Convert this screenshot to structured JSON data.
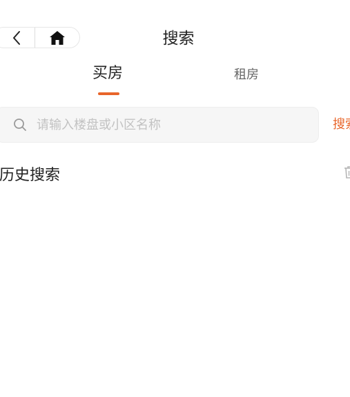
{
  "header": {
    "title": "搜索",
    "back_icon": "chevron-left-icon",
    "home_icon": "home-icon"
  },
  "tabs": [
    {
      "label": "买房",
      "active": true
    },
    {
      "label": "租房",
      "active": false
    }
  ],
  "search": {
    "placeholder": "请输入楼盘或小区名称",
    "value": "",
    "button_label": "搜索",
    "icon": "search-icon"
  },
  "history": {
    "title": "历史搜索",
    "clear_icon": "trash-icon"
  },
  "colors": {
    "accent": "#e8652a",
    "text_primary": "#222222",
    "text_secondary": "#666666",
    "placeholder": "#c2c2c2",
    "input_bg": "#f6f6f6"
  }
}
